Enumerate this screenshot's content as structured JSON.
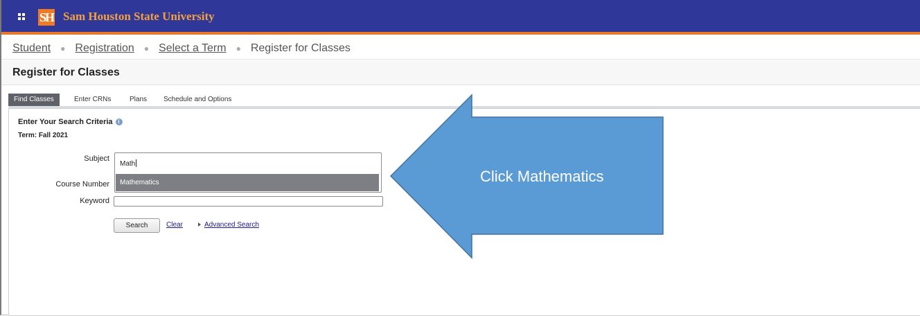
{
  "header": {
    "logo_text": "SH",
    "university_name": "Sam Houston State University",
    "colors": {
      "bar": "#2f3898",
      "accent": "#e8792b",
      "title": "#f5a03c"
    }
  },
  "breadcrumb": {
    "items": [
      "Student",
      "Registration",
      "Select a Term"
    ],
    "current": "Register for Classes"
  },
  "page": {
    "title": "Register for Classes"
  },
  "tabs": {
    "find_classes": "Find Classes",
    "enter_crns": "Enter CRNs",
    "plans": "Plans",
    "schedule_options": "Schedule and Options"
  },
  "search": {
    "heading": "Enter Your Search Criteria",
    "info_glyph": "i",
    "term": "Term: Fall 2021",
    "subject_label": "Subject",
    "subject_value": "Math",
    "subject_suggestion": "Mathematics",
    "course_number_label": "Course Number",
    "keyword_label": "Keyword",
    "keyword_value": "",
    "search_button": "Search",
    "clear_link": "Clear",
    "advanced_link": "Advanced Search"
  },
  "callout": {
    "text": "Click Mathematics",
    "fill": "#5b9bd5",
    "stroke": "#41719c"
  }
}
